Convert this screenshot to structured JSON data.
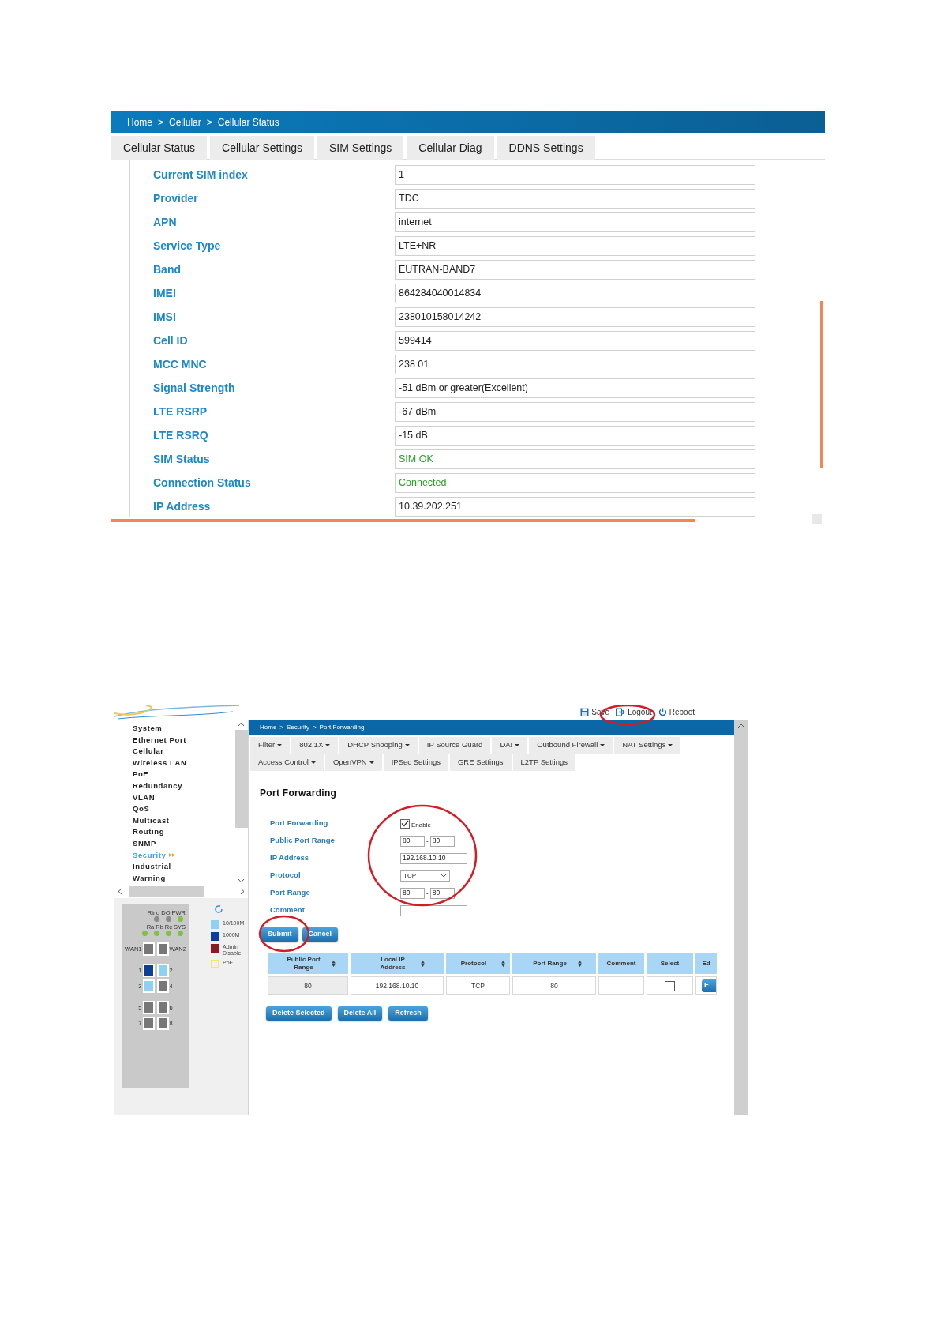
{
  "cellular": {
    "breadcrumb": [
      "Home",
      "Cellular",
      "Cellular Status"
    ],
    "separator": ">",
    "tabs": [
      "Cellular Status",
      "Cellular Settings",
      "SIM Settings",
      "Cellular Diag",
      "DDNS Settings"
    ],
    "fields": [
      {
        "label": "Current SIM index",
        "value": "1",
        "ok": false
      },
      {
        "label": "Provider",
        "value": "TDC",
        "ok": false
      },
      {
        "label": "APN",
        "value": "internet",
        "ok": false
      },
      {
        "label": "Service Type",
        "value": "LTE+NR",
        "ok": false
      },
      {
        "label": "Band",
        "value": "EUTRAN-BAND7",
        "ok": false
      },
      {
        "label": "IMEI",
        "value": "864284040014834",
        "ok": false
      },
      {
        "label": "IMSI",
        "value": "238010158014242",
        "ok": false
      },
      {
        "label": "Cell ID",
        "value": "599414",
        "ok": false
      },
      {
        "label": "MCC MNC",
        "value": "238 01",
        "ok": false
      },
      {
        "label": "Signal Strength",
        "value": "-51 dBm or greater(Excellent)",
        "ok": false
      },
      {
        "label": "LTE RSRP",
        "value": "-67 dBm",
        "ok": false
      },
      {
        "label": "LTE RSRQ",
        "value": "-15 dB",
        "ok": false
      },
      {
        "label": "SIM Status",
        "value": "SIM OK",
        "ok": true
      },
      {
        "label": "Connection Status",
        "value": "Connected",
        "ok": true
      },
      {
        "label": "IP Address",
        "value": "10.39.202.251",
        "ok": false
      }
    ]
  },
  "security": {
    "toolbar": [
      {
        "label": "Save",
        "kind": "save"
      },
      {
        "label": "Logout",
        "kind": "logout"
      },
      {
        "label": "Reboot",
        "kind": "reboot"
      }
    ],
    "breadcrumb": [
      "Home",
      "Security",
      "Port Forwarding"
    ],
    "separator": ">",
    "sidebar": {
      "items": [
        {
          "label": "System",
          "selected": false
        },
        {
          "label": "Ethernet Port",
          "selected": false
        },
        {
          "label": "Cellular",
          "selected": false
        },
        {
          "label": "Wireless LAN",
          "selected": false
        },
        {
          "label": "PoE",
          "selected": false
        },
        {
          "label": "Redundancy",
          "selected": false
        },
        {
          "label": "VLAN",
          "selected": false
        },
        {
          "label": "QoS",
          "selected": false
        },
        {
          "label": "Multicast",
          "selected": false
        },
        {
          "label": "Routing",
          "selected": false
        },
        {
          "label": "SNMP",
          "selected": false
        },
        {
          "label": "Security",
          "selected": true
        },
        {
          "label": "Industrial",
          "selected": false
        },
        {
          "label": "Warning",
          "selected": false
        }
      ]
    },
    "device": {
      "led_rows": [
        [
          {
            "label": "Ring",
            "on": false
          },
          {
            "label": "DO",
            "on": false
          },
          {
            "label": "PWR",
            "on": true
          }
        ],
        [
          {
            "label": "Ra",
            "on": true
          },
          {
            "label": "Rb",
            "on": true
          },
          {
            "label": "Rc",
            "on": true
          },
          {
            "label": "SYS",
            "on": true
          }
        ]
      ],
      "ports": [
        {
          "label": "WAN1",
          "color": "#777777"
        },
        {
          "label": "WAN2",
          "color": "#777777"
        },
        {
          "label": "1",
          "color": "#0d3f96"
        },
        {
          "label": "2",
          "color": "#8fd0f5"
        },
        {
          "label": "3",
          "color": "#8fd0f5"
        },
        {
          "label": "4",
          "color": "#777777"
        },
        {
          "label": "5",
          "color": "#777777"
        },
        {
          "label": "6",
          "color": "#777777"
        },
        {
          "label": "7",
          "color": "#777777"
        },
        {
          "label": "8",
          "color": "#777777"
        }
      ],
      "legend": [
        {
          "label": "10/100M",
          "color": "#8fd0f5",
          "kind": "fill"
        },
        {
          "label": "1000M",
          "color": "#0d3f96",
          "kind": "fill"
        },
        {
          "label": "Admin Disable",
          "color": "#8b1a22",
          "kind": "fill"
        },
        {
          "label": "PoE",
          "color": "#f5e663",
          "kind": "outline"
        }
      ]
    },
    "menu_rows": [
      [
        {
          "label": "Filter",
          "dropdown": true
        },
        {
          "label": "802.1X",
          "dropdown": true
        },
        {
          "label": "DHCP Snooping",
          "dropdown": true
        },
        {
          "label": "IP Source Guard",
          "dropdown": false
        },
        {
          "label": "DAI",
          "dropdown": true
        },
        {
          "label": "Outbound Firewall",
          "dropdown": true
        },
        {
          "label": "NAT Settings",
          "dropdown": true
        }
      ],
      [
        {
          "label": "Access Control",
          "dropdown": true
        },
        {
          "label": "OpenVPN",
          "dropdown": true
        },
        {
          "label": "IPSec Settings",
          "dropdown": false
        },
        {
          "label": "GRE Settings",
          "dropdown": false
        },
        {
          "label": "L2TP Settings",
          "dropdown": false
        }
      ]
    ],
    "heading": "Port Forwarding",
    "form": [
      {
        "label": "Port Forwarding",
        "kind": "checkbox",
        "checked": true,
        "text": "Enable"
      },
      {
        "label": "Public Port Range",
        "kind": "range",
        "from": "80",
        "to": "80",
        "separator": "-"
      },
      {
        "label": "IP Address",
        "kind": "text",
        "value": "192.168.10.10"
      },
      {
        "label": "Protocol",
        "kind": "select",
        "value": "TCP"
      },
      {
        "label": "Port Range",
        "kind": "range",
        "from": "80",
        "to": "80",
        "separator": "-"
      },
      {
        "label": "Comment",
        "kind": "text"
      }
    ],
    "form_buttons": [
      "Submit",
      "Cancel"
    ],
    "table": {
      "columns": [
        {
          "label": "Public Port Range",
          "sortable": true
        },
        {
          "label": "Local IP Address",
          "sortable": true
        },
        {
          "label": "Protocol",
          "sortable": true
        },
        {
          "label": "Port Range",
          "sortable": true
        },
        {
          "label": "Comment",
          "sortable": false
        },
        {
          "label": "Select",
          "sortable": false
        },
        {
          "label": "Ed",
          "sortable": false
        }
      ],
      "rows": [
        [
          {
            "kind": "text",
            "text": "80",
            "shaded": true
          },
          {
            "kind": "text",
            "text": "192.168.10.10",
            "shaded": false
          },
          {
            "kind": "text",
            "text": "TCP",
            "shaded": false
          },
          {
            "kind": "text",
            "text": "80",
            "shaded": false
          },
          {
            "kind": "text",
            "shaded": false
          },
          {
            "kind": "checkbox",
            "checked": false
          },
          {
            "kind": "button",
            "text": "E"
          }
        ]
      ]
    },
    "table_buttons": [
      "Delete Selected",
      "Delete All",
      "Refresh"
    ]
  }
}
